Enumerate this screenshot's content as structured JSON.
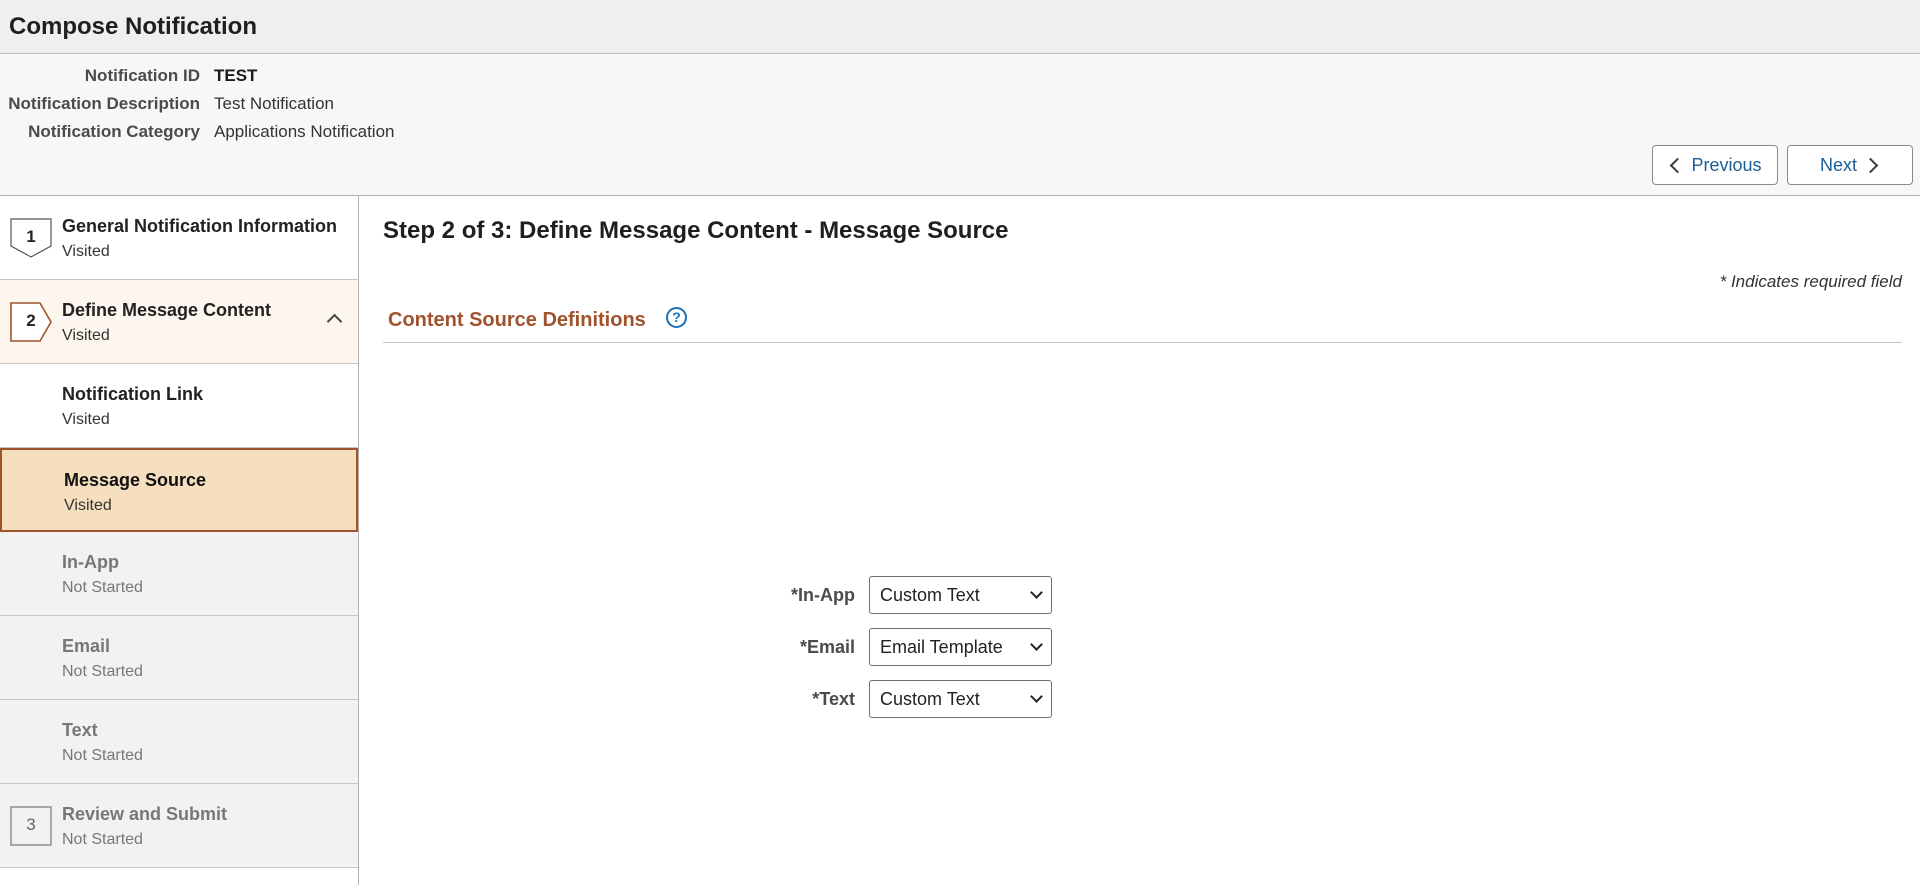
{
  "page": {
    "title": "Compose Notification"
  },
  "info": [
    {
      "label": "Notification ID",
      "value": "TEST"
    },
    {
      "label": "Notification Description",
      "value": "Test Notification"
    },
    {
      "label": "Notification Category",
      "value": "Applications Notification"
    }
  ],
  "nav": {
    "previous": "Previous",
    "next": "Next"
  },
  "steps": [
    {
      "number": "1",
      "title": "General Notification Information",
      "status": "Visited"
    },
    {
      "number": "2",
      "title": "Define Message Content",
      "status": "Visited"
    },
    {
      "title": "Notification Link",
      "status": "Visited"
    },
    {
      "title": "Message Source",
      "status": "Visited"
    },
    {
      "title": "In-App",
      "status": "Not Started"
    },
    {
      "title": "Email",
      "status": "Not Started"
    },
    {
      "title": "Text",
      "status": "Not Started"
    },
    {
      "number": "3",
      "title": "Review and Submit",
      "status": "Not Started"
    }
  ],
  "main": {
    "heading": "Step 2 of 3: Define Message Content - Message Source",
    "required_note": "* Indicates required field",
    "section_title": "Content Source Definitions",
    "help_icon": "?",
    "fields": [
      {
        "label": "In-App",
        "value": "Custom Text"
      },
      {
        "label": "Email",
        "value": "Email Template"
      },
      {
        "label": "Text",
        "value": "Custom Text"
      }
    ]
  },
  "colors": {
    "accent": "#a0522d",
    "selected_bg": "#f6dfbf",
    "link": "#1a5e99"
  }
}
